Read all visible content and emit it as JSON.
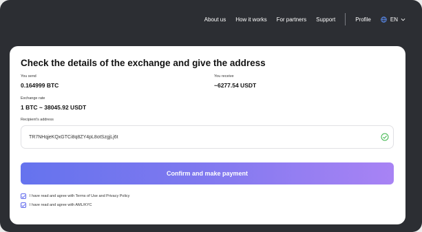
{
  "nav": {
    "links": [
      "About us",
      "How it works",
      "For partners",
      "Support"
    ],
    "profile": "Profile",
    "language": "EN",
    "globe_icon": "globe-icon",
    "chevron_icon": "chevron-down-icon"
  },
  "exchange": {
    "title": "Check the details of the exchange and give the address",
    "send_label": "You send",
    "send_value": "0.164999 BTC",
    "receive_label": "You receive",
    "receive_value": "~6277.54 USDT",
    "rate_label": "Exchange rate",
    "rate_value": "1 BTC ~ 38045.92 USDT",
    "address_label": "Recipient's address",
    "address_value": "TR7NHqjeKQxGTCi8q8ZY4pL8otSzgjLj6t",
    "address_valid_icon": "check-circle-icon",
    "confirm_label": "Confirm and make payment",
    "terms_label": "I have read and agree with Terms of Use and Privacy Policy",
    "terms_checked": true,
    "amlkyc_label": "I have read and agree with AML/KYC",
    "amlkyc_checked": true
  },
  "colors": {
    "header_bg": "#2c2e33",
    "card_bg": "#ffffff",
    "accent_start": "#6573ee",
    "accent_end": "#a883f4",
    "valid_green": "#3bb54a"
  }
}
